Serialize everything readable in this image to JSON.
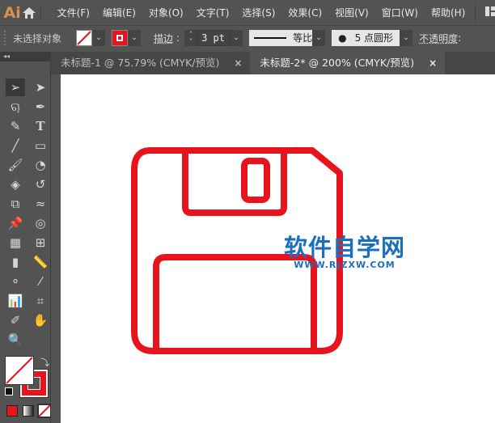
{
  "app": {
    "logo": "Ai"
  },
  "menu": [
    "文件(F)",
    "编辑(E)",
    "对象(O)",
    "文字(T)",
    "选择(S)",
    "效果(C)",
    "视图(V)",
    "窗口(W)",
    "帮助(H)"
  ],
  "control": {
    "selection": "未选择对象",
    "stroke_label": "描边",
    "stroke_value": "3 pt",
    "profile": "等比",
    "brush": "5 点圆形",
    "opacity_label": "不透明度"
  },
  "tabs": [
    {
      "label": "未标题-1 @ 75.79% (CMYK/预览)",
      "active": false
    },
    {
      "label": "未标题-2* @ 200% (CMYK/预览)",
      "active": true
    }
  ],
  "watermark": {
    "title": "软件自学网",
    "url": "WWW.RJZXW.COM"
  },
  "colors": {
    "stroke": "#e8141d",
    "ui": "#535353"
  }
}
